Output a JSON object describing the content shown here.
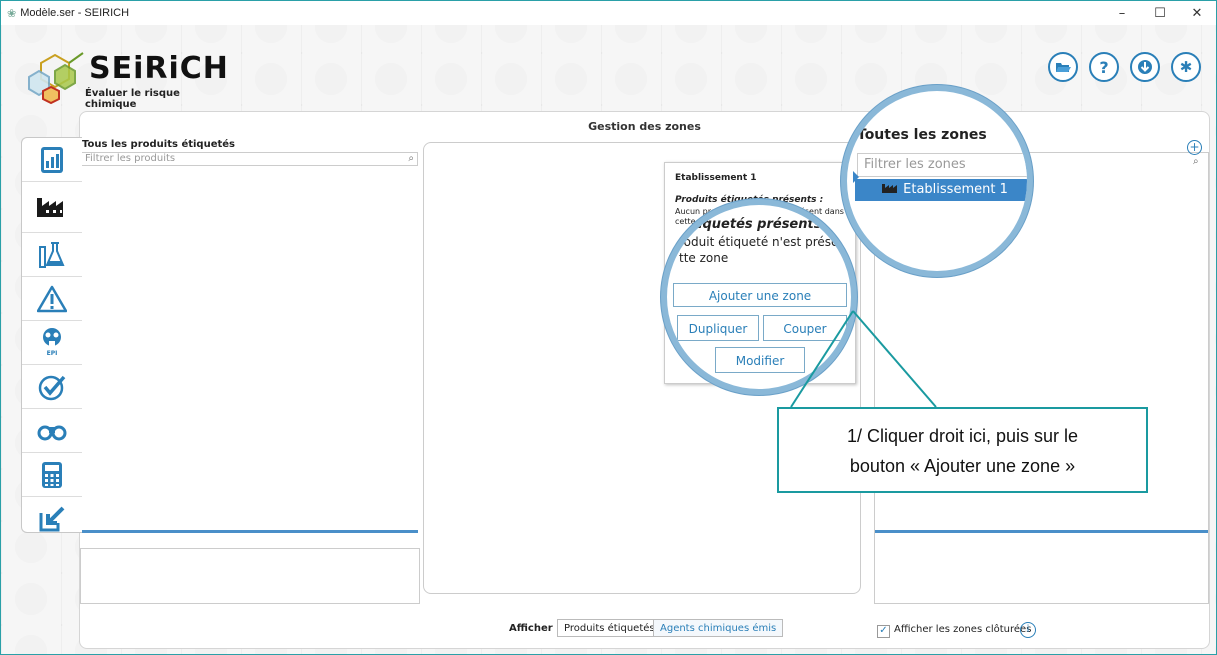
{
  "window": {
    "title": "Modèle.ser - SEIRICH",
    "minimize": "–",
    "maximize": "☐",
    "close": "✕"
  },
  "logo": {
    "title": "SEiRiCH",
    "subtitle": "Évaluer le risque chimique"
  },
  "toolbar": {
    "open_icon": "folder-open-icon",
    "help_label": "?",
    "download_icon": "download-icon",
    "settings_icon": "gear-icon"
  },
  "sidebar": {
    "items": [
      {
        "icon": "dashboard-icon"
      },
      {
        "icon": "factory-icon"
      },
      {
        "icon": "flask-icon"
      },
      {
        "icon": "warning-icon"
      },
      {
        "icon": "ppe-icon",
        "label": "EPI"
      },
      {
        "icon": "check-icon"
      },
      {
        "icon": "binoculars-icon"
      },
      {
        "icon": "calculator-icon"
      },
      {
        "icon": "export-icon"
      }
    ]
  },
  "main": {
    "header": "Gestion des zones",
    "left": {
      "title": "Tous les produits étiquetés",
      "filter_placeholder": "Filtrer les produits"
    },
    "right": {
      "title": "Toutes les zones",
      "filter_placeholder": "Filtrer les zones",
      "zones": [
        "Etablissement 1"
      ]
    },
    "context": {
      "title": "Etablissement 1",
      "subtitle": "Produits étiquetés présents :",
      "text": "Aucun produit étiqueté n'est présent dans cette zone",
      "magnified_subtitle": "étiquetés présents :",
      "magnified_text_line1": "roduit étiqueté n'est prése",
      "magnified_text_line2": "tte zone",
      "add_zone": "Ajouter une zone",
      "duplicate": "Dupliquer",
      "cut": "Couper",
      "modify": "Modifier"
    }
  },
  "callout": {
    "line1": "1/ Cliquer droit ici, puis sur le",
    "line2": "bouton « Ajouter une zone »"
  },
  "bottom": {
    "afficher_label": "Afficher :",
    "option1": "Produits étiquetés",
    "option2": "Agents chimiques émis",
    "show_closed": "Afficher les zones clôturées",
    "checked": "✓",
    "info": "i"
  },
  "colors": {
    "accent": "#2a7fb8",
    "teal": "#1a9aa0",
    "selected": "#3b86c8"
  }
}
